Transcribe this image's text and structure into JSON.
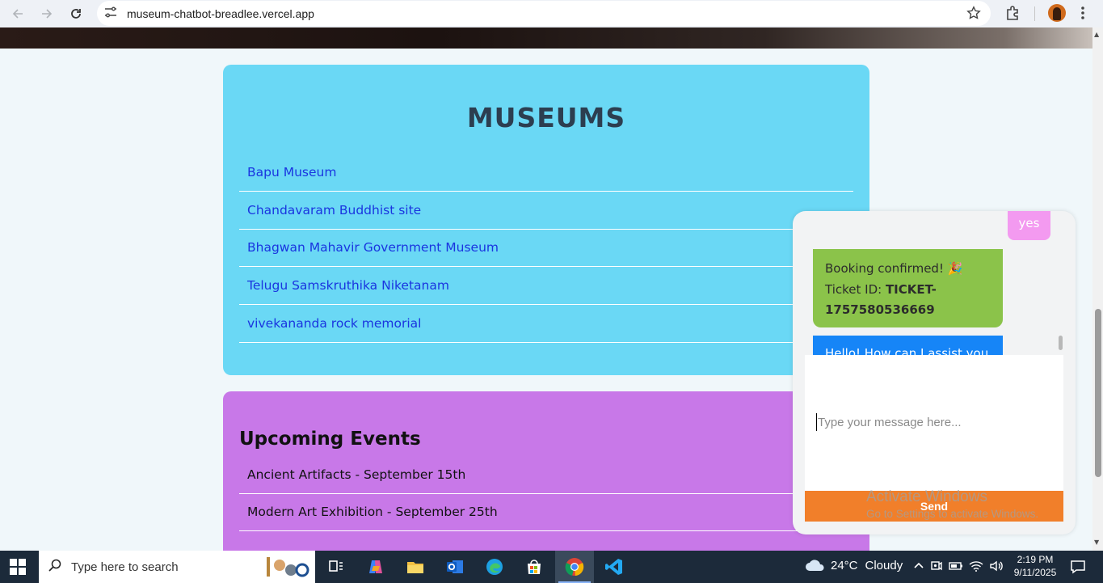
{
  "browser": {
    "url": "museum-chatbot-breadlee.vercel.app"
  },
  "museums": {
    "title": "MUSEUMS",
    "items": [
      "Bapu Museum",
      "Chandavaram Buddhist site",
      "Bhagwan Mahavir Government Museum",
      "Telugu Samskruthika Niketanam",
      "vivekananda rock memorial"
    ]
  },
  "events": {
    "title": "Upcoming Events",
    "items": [
      "Ancient Artifacts - September 15th",
      "Modern Art Exhibition - September 25th"
    ]
  },
  "chat": {
    "user_message": "yes",
    "confirm_line1": "Booking confirmed! 🎉",
    "ticket_label": "Ticket ID: ",
    "ticket_id": "TICKET-1757580536669",
    "bot_greeting": "Hello! How can I assist you",
    "input_placeholder": "Type your message here...",
    "send_label": "Send"
  },
  "watermark": {
    "line1": "Activate Windows",
    "line2": "Go to Settings to activate Windows."
  },
  "taskbar": {
    "search_placeholder": "Type here to search",
    "weather_temp": "24°C",
    "weather_desc": "Cloudy",
    "time": "2:19 PM",
    "date": "9/11/2025"
  },
  "colors": {
    "museums_bg": "#6ad8f5",
    "events_bg": "#c878e8",
    "confirm_bubble": "#8bc34a",
    "bot_bubble": "#1685f7",
    "user_bubble": "#f39af0",
    "send_button": "#f17f2a"
  }
}
